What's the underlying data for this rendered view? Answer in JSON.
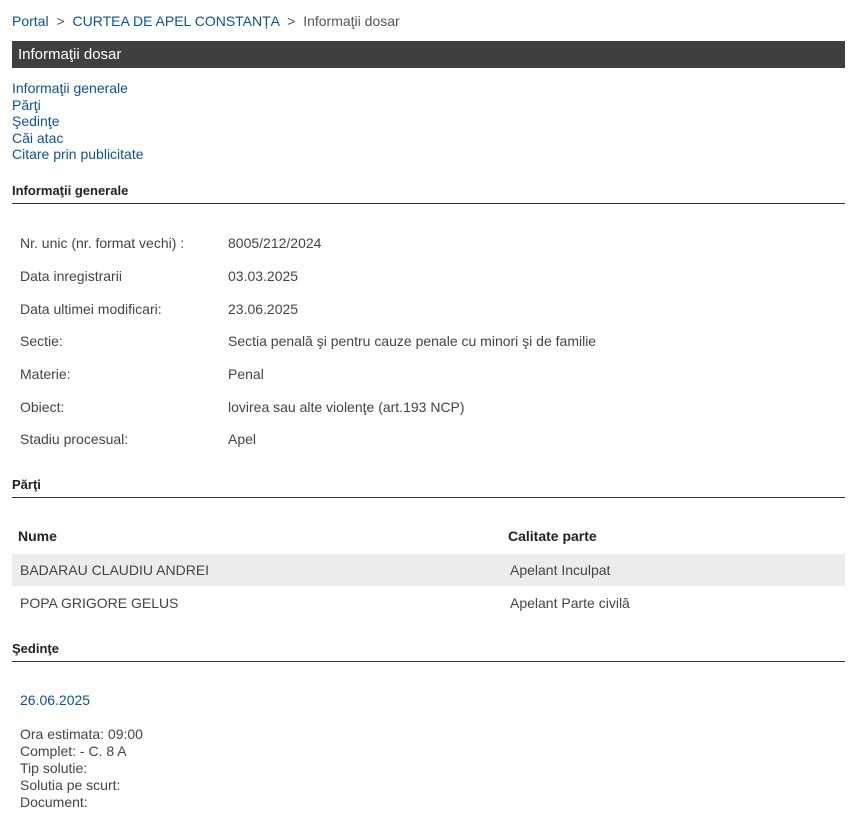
{
  "breadcrumb": {
    "items": [
      "Portal",
      "CURTEA DE APEL CONSTANȚA"
    ],
    "separator": ">",
    "current": "Informaţii dosar"
  },
  "title": "Informaţii dosar",
  "nav": {
    "items": [
      "Informaţii generale",
      "Părţi",
      "Şedinţe",
      "Căi atac",
      "Citare prin publicitate"
    ]
  },
  "sections": {
    "general": "Informaţii generale",
    "parties": "Părţi",
    "hearings": "Şedinţe"
  },
  "general_info": [
    {
      "label": "Nr. unic (nr. format vechi) :",
      "value": "8005/212/2024"
    },
    {
      "label": "Data inregistrarii",
      "value": "03.03.2025"
    },
    {
      "label": "Data ultimei modificari:",
      "value": "23.06.2025"
    },
    {
      "label": "Sectie:",
      "value": "Sectia penală şi pentru cauze penale cu minori şi de familie"
    },
    {
      "label": "Materie:",
      "value": "Penal"
    },
    {
      "label": "Obiect:",
      "value": "lovirea sau alte violenţe (art.193 NCP)"
    },
    {
      "label": "Stadiu procesual:",
      "value": "Apel"
    }
  ],
  "parties": {
    "headers": {
      "name": "Nume",
      "role": "Calitate parte"
    },
    "rows": [
      {
        "name": "BADARAU CLAUDIU ANDREI",
        "role": "Apelant Inculpat"
      },
      {
        "name": "POPA GRIGORE GELUS",
        "role": "Apelant Parte civilă"
      }
    ]
  },
  "hearings": [
    {
      "date": "26.06.2025",
      "details": [
        "Ora estimata: 09:00",
        "Complet: - C. 8 A",
        "Tip solutie:",
        "Solutia pe scurt:",
        "Document:"
      ]
    }
  ],
  "colors": {
    "link": "#0b5394",
    "titlebar": "#3f3f3f",
    "row_shade": "#ececec"
  }
}
